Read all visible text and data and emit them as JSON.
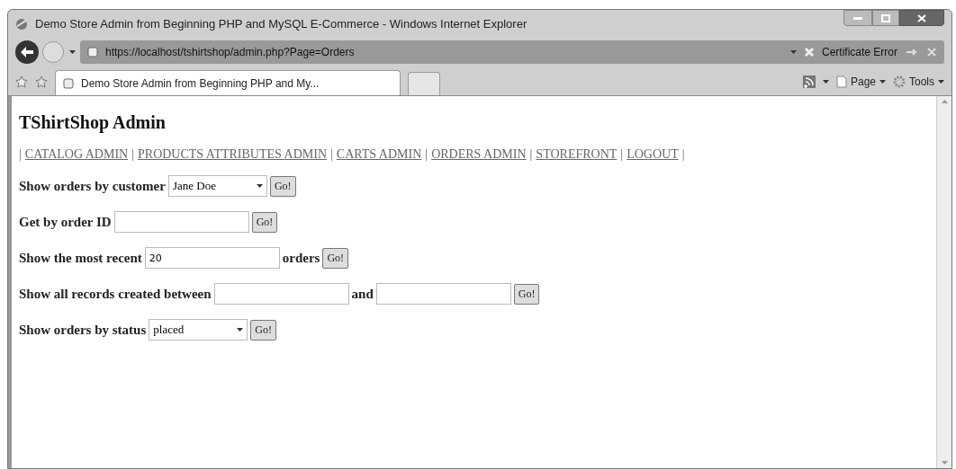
{
  "window": {
    "title": "Demo Store Admin from Beginning PHP and MySQL E-Commerce - Windows Internet Explorer"
  },
  "address_bar": {
    "url": "https://localhost/tshirtshop/admin.php?Page=Orders",
    "certificate_error": "Certificate Error"
  },
  "tabs": [
    {
      "label": "Demo Store Admin from Beginning PHP and My...",
      "selected": true
    }
  ],
  "command_bar": [
    {
      "label": "Page",
      "kind": "page"
    },
    {
      "label": "Tools",
      "kind": "tools"
    }
  ],
  "page": {
    "heading": "TShirtShop Admin",
    "nav": [
      {
        "kind": "separator",
        "text": "|"
      },
      {
        "kind": "link",
        "text": "CATALOG ADMIN"
      },
      {
        "kind": "separator",
        "text": "|"
      },
      {
        "kind": "link",
        "text": "PRODUCTS ATTRIBUTES ADMIN"
      },
      {
        "kind": "separator",
        "text": "|"
      },
      {
        "kind": "link",
        "text": "CARTS ADMIN"
      },
      {
        "kind": "separator",
        "text": "|"
      },
      {
        "kind": "link",
        "text": "ORDERS ADMIN"
      },
      {
        "kind": "separator",
        "text": "|"
      },
      {
        "kind": "link",
        "text": "STOREFRONT"
      },
      {
        "kind": "separator",
        "text": "|"
      },
      {
        "kind": "link",
        "text": "LOGOUT"
      },
      {
        "kind": "separator",
        "text": "|"
      }
    ],
    "forms": [
      {
        "parts": [
          {
            "kind": "label",
            "text": "Show orders by customer"
          },
          {
            "kind": "select",
            "value": "Jane Doe"
          },
          {
            "kind": "button",
            "text": "Go!"
          }
        ]
      },
      {
        "parts": [
          {
            "kind": "label",
            "text": "Get by order ID"
          },
          {
            "kind": "input"
          },
          {
            "kind": "button",
            "text": "Go!"
          }
        ]
      },
      {
        "parts": [
          {
            "kind": "label",
            "text": "Show the most recent"
          },
          {
            "kind": "input",
            "value": "20"
          },
          {
            "kind": "label",
            "text": "orders"
          },
          {
            "kind": "button",
            "text": "Go!"
          }
        ]
      },
      {
        "parts": [
          {
            "kind": "label",
            "text": "Show all records created between"
          },
          {
            "kind": "input"
          },
          {
            "kind": "label",
            "text": "and"
          },
          {
            "kind": "input"
          },
          {
            "kind": "button",
            "text": "Go!"
          }
        ]
      },
      {
        "parts": [
          {
            "kind": "label",
            "text": "Show orders by status"
          },
          {
            "kind": "select",
            "value": "placed"
          },
          {
            "kind": "button",
            "text": "Go!"
          }
        ]
      }
    ]
  }
}
